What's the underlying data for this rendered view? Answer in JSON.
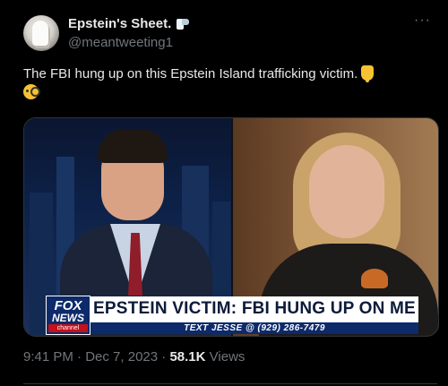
{
  "author": {
    "name": "Epstein's Sheet.",
    "handle": "@meantweeting1",
    "avatar_icon": "toilet-paper-figure-avatar",
    "name_emoji_icon": "toilet-paper-roll-icon"
  },
  "more_label": "···",
  "tweet": {
    "text": "The FBI hung up on this Epstein Island trafficking victim.",
    "emojis": [
      "pointing-down-icon",
      "face-with-monocle-icon"
    ]
  },
  "media": {
    "chyron_headline": "EPSTEIN VICTIM: FBI HUNG UP ON ME",
    "chyron_sub": "TEXT JESSE @ (929) 286-7479",
    "logo_top": "FOX",
    "logo_mid": "NEWS",
    "logo_bottom": "channel"
  },
  "meta": {
    "time": "9:41 PM",
    "dot": "·",
    "date": "Dec 7, 2023",
    "views_count": "58.1K",
    "views_label": "Views"
  }
}
